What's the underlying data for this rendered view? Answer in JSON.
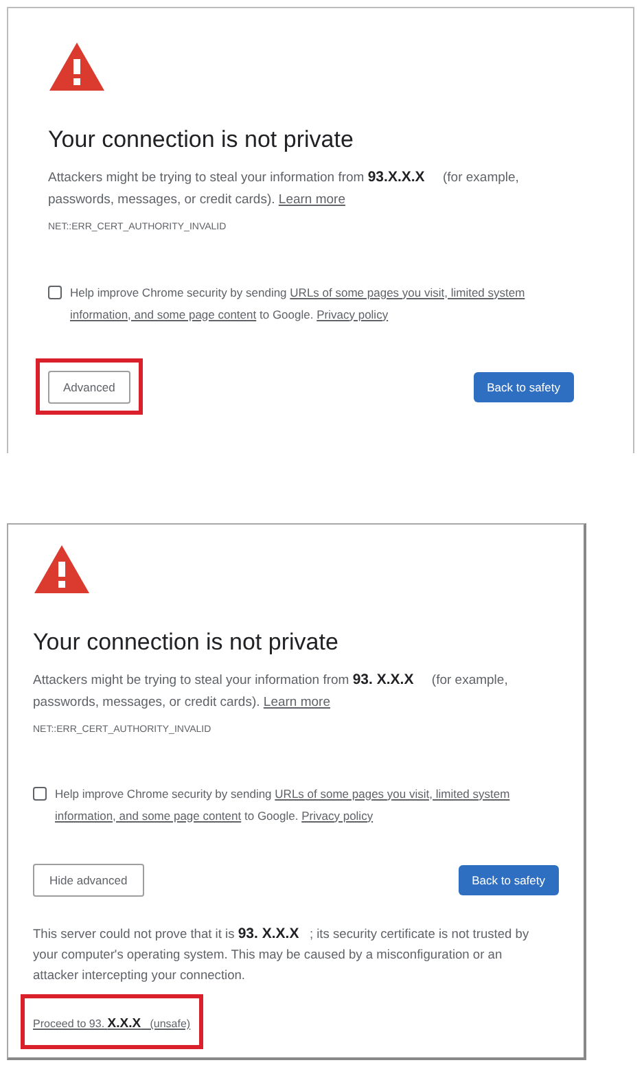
{
  "panels": [
    {
      "title": "Your connection is not private",
      "description": "Attackers might be trying to steal your information from **93.X.X.X**     (for example, passwords, messages, or credit cards).",
      "learn_more": "Learn more",
      "error_code": "NET::ERR_CERT_AUTHORITY_INVALID",
      "checkbox": {
        "checked": false,
        "parts": [
          {
            "kind": "text",
            "text": "Help improve Chrome security by sending"
          },
          {
            "kind": "link",
            "text": "URLs of some pages you visit, limited system"
          },
          {
            "kind": "break"
          },
          {
            "kind": "link",
            "text": "information, and some page content"
          },
          {
            "kind": "text",
            "text": "to Google."
          },
          {
            "kind": "link",
            "text": "Privacy policy"
          }
        ]
      },
      "buttons": [
        {
          "kind": "secondary",
          "label": "Advanced",
          "highlighted": true
        },
        {
          "kind": "primary",
          "label": "Back to safety",
          "highlighted": false
        }
      ]
    },
    {
      "title": "Your connection is not private",
      "description": "Attackers might be trying to steal your information from **93. X.X.X**     (for example, passwords, messages, or credit cards).",
      "learn_more": "Learn more",
      "error_code": "NET::ERR_CERT_AUTHORITY_INVALID",
      "checkbox": {
        "checked": false,
        "parts": [
          {
            "kind": "text",
            "text": "Help improve Chrome security by sending"
          },
          {
            "kind": "link",
            "text": "URLs of some pages you visit, limited system"
          },
          {
            "kind": "break"
          },
          {
            "kind": "link",
            "text": "information, and some page content"
          },
          {
            "kind": "text",
            "text": "to Google."
          },
          {
            "kind": "link",
            "text": "Privacy policy"
          }
        ]
      },
      "buttons": [
        {
          "kind": "secondary",
          "label": "Hide advanced",
          "highlighted": false
        },
        {
          "kind": "primary",
          "label": "Back to safety",
          "highlighted": false
        }
      ],
      "details": "This server could not prove that it is **93. X.X.X**   ; its security certificate is not trusted by your computer's operating system. This may be caused by a misconfiguration or an attacker intercepting your connection.",
      "proceed": {
        "text": "Proceed to 93. **X.X.X**   (unsafe)",
        "highlighted": true
      }
    }
  ]
}
